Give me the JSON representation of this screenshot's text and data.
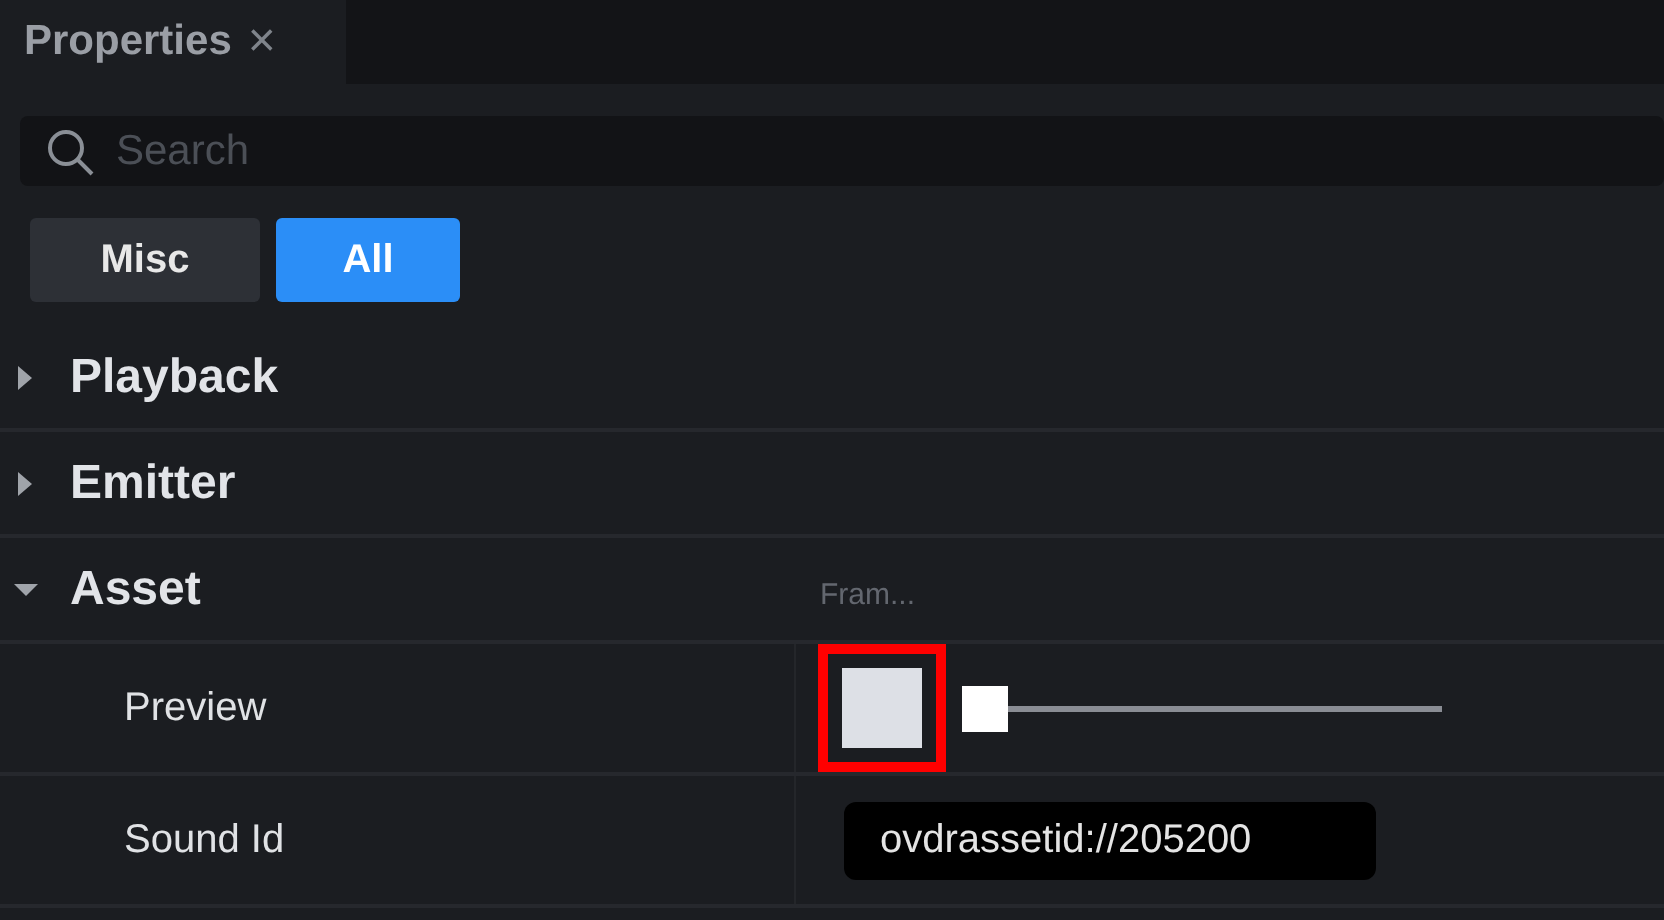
{
  "tabs": [
    {
      "label": "Properties",
      "close": "×"
    }
  ],
  "search": {
    "placeholder": "Search"
  },
  "filters": [
    {
      "label": "Misc",
      "selected": false
    },
    {
      "label": "All",
      "selected": true
    }
  ],
  "sections": [
    {
      "title": "Playback",
      "expanded": false
    },
    {
      "title": "Emitter",
      "expanded": false
    },
    {
      "title": "Asset",
      "expanded": true,
      "hint": "Fram...",
      "rows": [
        {
          "kind": "preview",
          "label": "Preview",
          "highlighted": true,
          "level": 0
        },
        {
          "kind": "text",
          "label": "Sound Id",
          "value": "ovdrassetid://205200"
        }
      ]
    }
  ]
}
